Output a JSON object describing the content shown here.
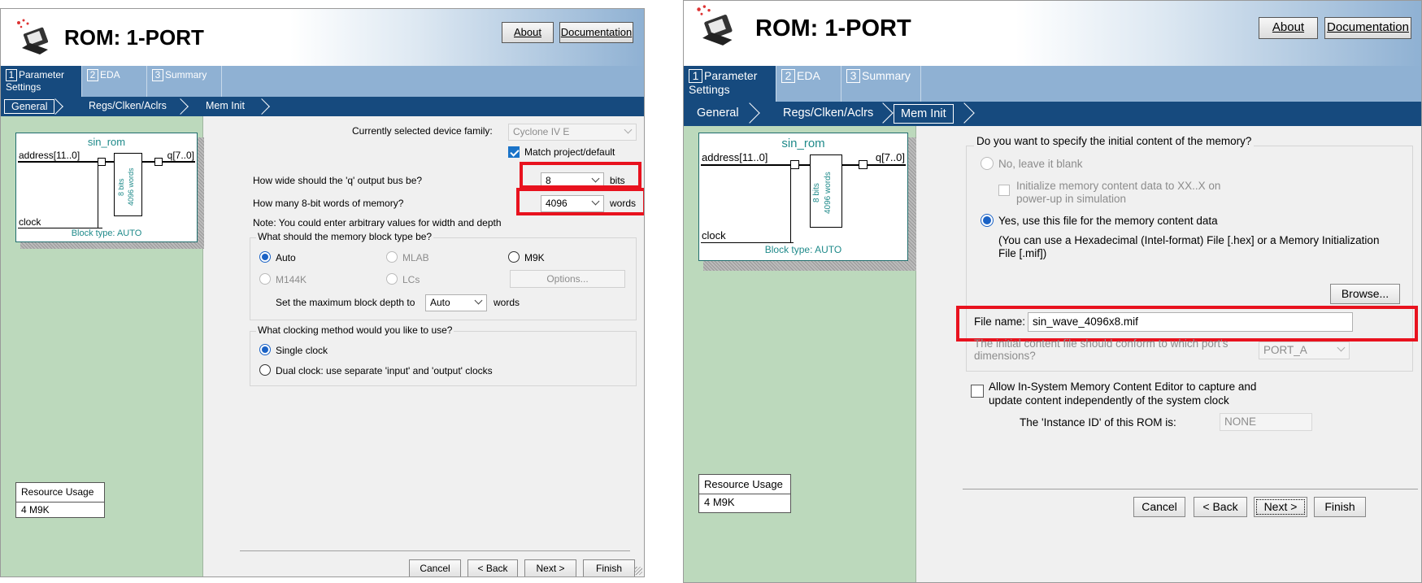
{
  "left": {
    "title": "ROM: 1-PORT",
    "about": "About",
    "documentation": "Documentation",
    "tabs": [
      {
        "num": "1",
        "label": "Parameter Settings"
      },
      {
        "num": "2",
        "label": "EDA"
      },
      {
        "num": "3",
        "label": "Summary"
      }
    ],
    "crumbs": [
      "General",
      "Regs/Clken/Aclrs",
      "Mem Init"
    ],
    "symbol": {
      "name": "sin_rom",
      "address": "address[11..0]",
      "q": "q[7..0]",
      "clock": "clock",
      "bits": "8 bits",
      "words": "4096 words",
      "block_type": "Block type: AUTO"
    },
    "resource": {
      "header": "Resource Usage",
      "value": "4 M9K"
    },
    "device_label": "Currently selected device family:",
    "device_value": "Cyclone IV E",
    "match_label": "Match project/default",
    "width_label": "How wide should the 'q' output bus be?",
    "width_value": "8",
    "width_unit": "bits",
    "words_label": "How many 8-bit words of memory?",
    "words_value": "4096",
    "words_unit": "words",
    "note": "Note: You could enter arbitrary values for width and depth",
    "block_group": "What should the memory block type be?",
    "block_opts": [
      "Auto",
      "MLAB",
      "M9K",
      "M144K",
      "LCs"
    ],
    "options_btn": "Options...",
    "depth_label": "Set the maximum block depth to",
    "depth_value": "Auto",
    "depth_unit": "words",
    "clock_group": "What clocking method would you like to use?",
    "clock_opts": [
      "Single clock",
      "Dual clock: use separate 'input' and 'output' clocks"
    ],
    "buttons": [
      "Cancel",
      "< Back",
      "Next >",
      "Finish"
    ]
  },
  "right": {
    "title": "ROM: 1-PORT",
    "about": "About",
    "documentation": "Documentation",
    "tabs": [
      {
        "num": "1",
        "label": "Parameter Settings"
      },
      {
        "num": "2",
        "label": "EDA"
      },
      {
        "num": "3",
        "label": "Summary"
      }
    ],
    "crumbs": [
      "General",
      "Regs/Clken/Aclrs",
      "Mem Init"
    ],
    "symbol": {
      "name": "sin_rom",
      "address": "address[11..0]",
      "q": "q[7..0]",
      "clock": "clock",
      "bits": "8 bits",
      "words": "4096 words",
      "block_type": "Block type: AUTO"
    },
    "resource": {
      "header": "Resource Usage",
      "value": "4 M9K"
    },
    "init_question": "Do you want to specify the initial content of the memory?",
    "opt_no": "No, leave it blank",
    "init_xx": "Initialize memory content data to XX..X on power-up in simulation",
    "opt_yes": "Yes, use this file for the memory content data",
    "hint": "(You can use a Hexadecimal (Intel-format) File [.hex] or a Memory Initialization File [.mif])",
    "browse": "Browse...",
    "file_label": "File name:",
    "file_value": "sin_wave_4096x8.mif",
    "port_question": "The initial content file should conform to which port's dimensions?",
    "port_value": "PORT_A",
    "editor_label": "Allow In-System Memory Content Editor to capture and update content independently of the system clock",
    "instance_label": "The 'Instance ID' of this ROM is:",
    "instance_value": "NONE",
    "buttons": [
      "Cancel",
      "< Back",
      "Next >",
      "Finish"
    ]
  },
  "colors": {
    "highlight": "#e8121e",
    "nav": "#164a7e",
    "tabbar": "#8fb1d3",
    "sidebar": "#bcd9bc"
  }
}
